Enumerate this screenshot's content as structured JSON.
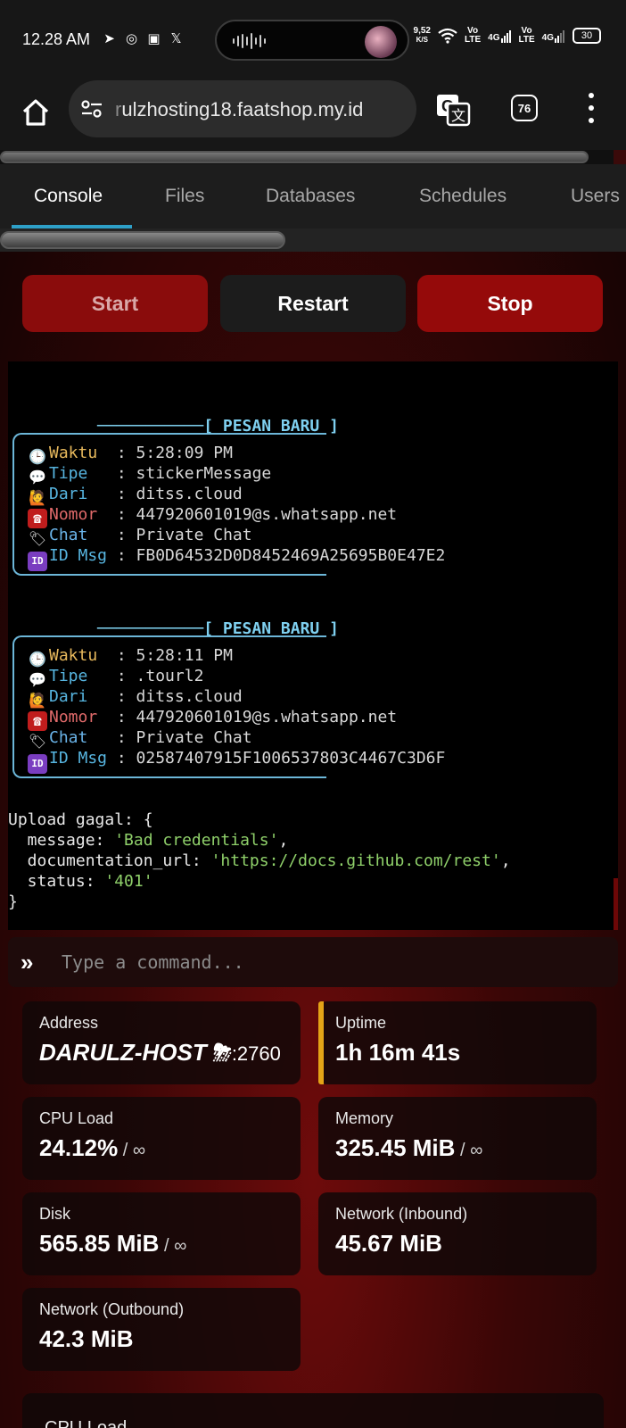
{
  "status_bar": {
    "time": "12.28 AM",
    "net_speed_value": "9,52",
    "net_speed_unit": "K/S",
    "carrier1_top": "Vo",
    "carrier1_bottom": "LTE",
    "carrier2_top": "Vo",
    "carrier2_bottom": "LTE",
    "network_type": "4G",
    "battery": "30"
  },
  "browser": {
    "url_prefix": "r",
    "url": "ulzhosting18.faatshop.my.id",
    "tab_count": "76"
  },
  "nav": {
    "tabs": [
      {
        "label": "Console"
      },
      {
        "label": "Files"
      },
      {
        "label": "Databases"
      },
      {
        "label": "Schedules"
      },
      {
        "label": "Users"
      }
    ]
  },
  "actions": {
    "start": "Start",
    "restart": "Restart",
    "stop": "Stop"
  },
  "console": {
    "messages": [
      {
        "header": "───────────[ PESAN BARU ]",
        "lines": [
          {
            "icon": "🕒",
            "label": "Waktu ",
            "value": " : 5:28:09 PM"
          },
          {
            "icon": "💬",
            "label": "Tipe  ",
            "value": " : stickerMessage"
          },
          {
            "icon": "🙋",
            "label": "Dari  ",
            "value": " : ditss.cloud"
          },
          {
            "icon": "☎",
            "label": "Nomor ",
            "value": " : 447920601019@s.whatsapp.net"
          },
          {
            "icon": "🏷",
            "label": "Chat  ",
            "value": " : Private Chat"
          },
          {
            "icon": "ID",
            "label": "ID Msg",
            "value": " : FB0D64532D0D8452469A25695B0E47E2"
          }
        ]
      },
      {
        "header": "───────────[ PESAN BARU ]",
        "lines": [
          {
            "icon": "🕒",
            "label": "Waktu ",
            "value": " : 5:28:11 PM"
          },
          {
            "icon": "💬",
            "label": "Tipe  ",
            "value": " : .tourl2"
          },
          {
            "icon": "🙋",
            "label": "Dari  ",
            "value": " : ditss.cloud"
          },
          {
            "icon": "☎",
            "label": "Nomor ",
            "value": " : 447920601019@s.whatsapp.net"
          },
          {
            "icon": "🏷",
            "label": "Chat  ",
            "value": " : Private Chat"
          },
          {
            "icon": "ID",
            "label": "ID Msg",
            "value": " : 02587407915F1006537803C4467C3D6F"
          }
        ]
      }
    ],
    "error": {
      "line1": "Upload gagal: {",
      "message_key": "  message: ",
      "message_val": "'Bad credentials'",
      "doc_key": "  documentation_url: ",
      "doc_val": "'https://docs.github.com/rest'",
      "status_key": "  status: ",
      "status_val": "'401'",
      "close": "}"
    }
  },
  "command": {
    "prompt": "»",
    "placeholder": "Type a command..."
  },
  "stats": {
    "address_label": "Address",
    "address_host": "DARULZ-HOST",
    "address_emoji": "⛈",
    "address_port": ":2760",
    "uptime_label": "Uptime",
    "uptime_value": "1h 16m 41s",
    "cpu_label": "CPU Load",
    "cpu_value": "24.12%",
    "cpu_limit": " / ∞",
    "memory_label": "Memory",
    "memory_value": "325.45 MiB",
    "memory_limit": " / ∞",
    "disk_label": "Disk",
    "disk_value": "565.85 MiB",
    "disk_limit": " / ∞",
    "net_in_label": "Network (Inbound)",
    "net_in_value": "45.67 MiB",
    "net_out_label": "Network (Outbound)",
    "net_out_value": "42.3 MiB",
    "next_card_label": "CPU Load"
  },
  "colors": {
    "accent_blue": "#2ea0c8",
    "stop_red": "#950a0a",
    "uptime_accent": "#e4a417"
  }
}
